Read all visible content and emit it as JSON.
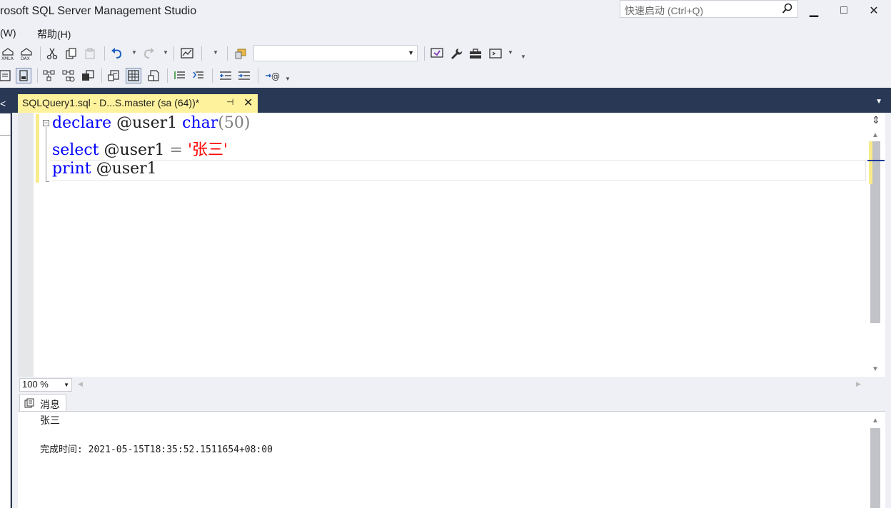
{
  "window": {
    "title": "rosoft SQL Server Management Studio",
    "quick_launch_placeholder": "快速启动 (Ctrl+Q)",
    "minimize": "▁",
    "maximize": "□",
    "close": "✕"
  },
  "menu": {
    "items": [
      "(W)",
      "帮助(H)"
    ]
  },
  "toolbar1": {
    "database_combo_value": ""
  },
  "document_tab": {
    "label": "SQLQuery1.sql - D...S.master (sa (64))*",
    "pin": "⊣",
    "close": "✕"
  },
  "editor": {
    "lines": [
      {
        "keyword1": "declare",
        "var": "@user1",
        "keyword2": "char",
        "paren": "(50)"
      },
      {
        "keyword1": "select",
        "var": "@user1",
        "op": "=",
        "string": "'张三'"
      },
      {
        "keyword1": "print",
        "var": "@user1"
      }
    ]
  },
  "zoom": {
    "value": "100 %"
  },
  "results": {
    "tab_label": "消息",
    "line1": "张三",
    "line2": "完成时间: 2021-05-15T18:35:52.1511654+08:00"
  },
  "colors": {
    "keyword": "#0000ff",
    "string": "#ff0000",
    "tab_active": "#fff29d",
    "band": "#293955"
  }
}
